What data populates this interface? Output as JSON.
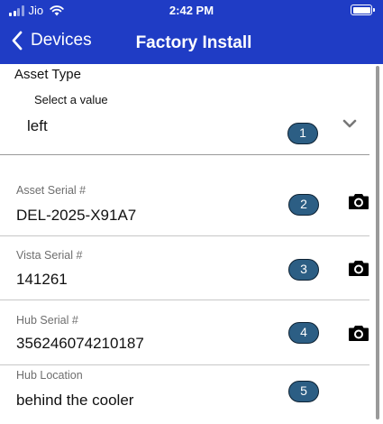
{
  "status": {
    "carrier": "Jio",
    "time": "2:42 PM"
  },
  "nav": {
    "back_label": "Devices",
    "title": "Factory Install"
  },
  "asset_type": {
    "label": "Asset Type",
    "placeholder": "Select a value",
    "value": "left",
    "badge": "1"
  },
  "fields": [
    {
      "label": "Asset Serial #",
      "value": "DEL-2025-X91A7",
      "badge": "2",
      "camera": true
    },
    {
      "label": "Vista Serial #",
      "value": "141261",
      "badge": "3",
      "camera": true
    },
    {
      "label": "Hub Serial #",
      "value": "356246074210187",
      "badge": "4",
      "camera": true
    },
    {
      "label": "Hub Location",
      "value": "behind the cooler",
      "badge": "5",
      "camera": false
    }
  ],
  "colors": {
    "header": "#1f3cc5",
    "badge": "#2c5e84"
  },
  "icons": [
    "signal-icon",
    "wifi-icon",
    "battery-icon",
    "back-chevron-icon",
    "chevron-down-icon",
    "camera-icon"
  ]
}
